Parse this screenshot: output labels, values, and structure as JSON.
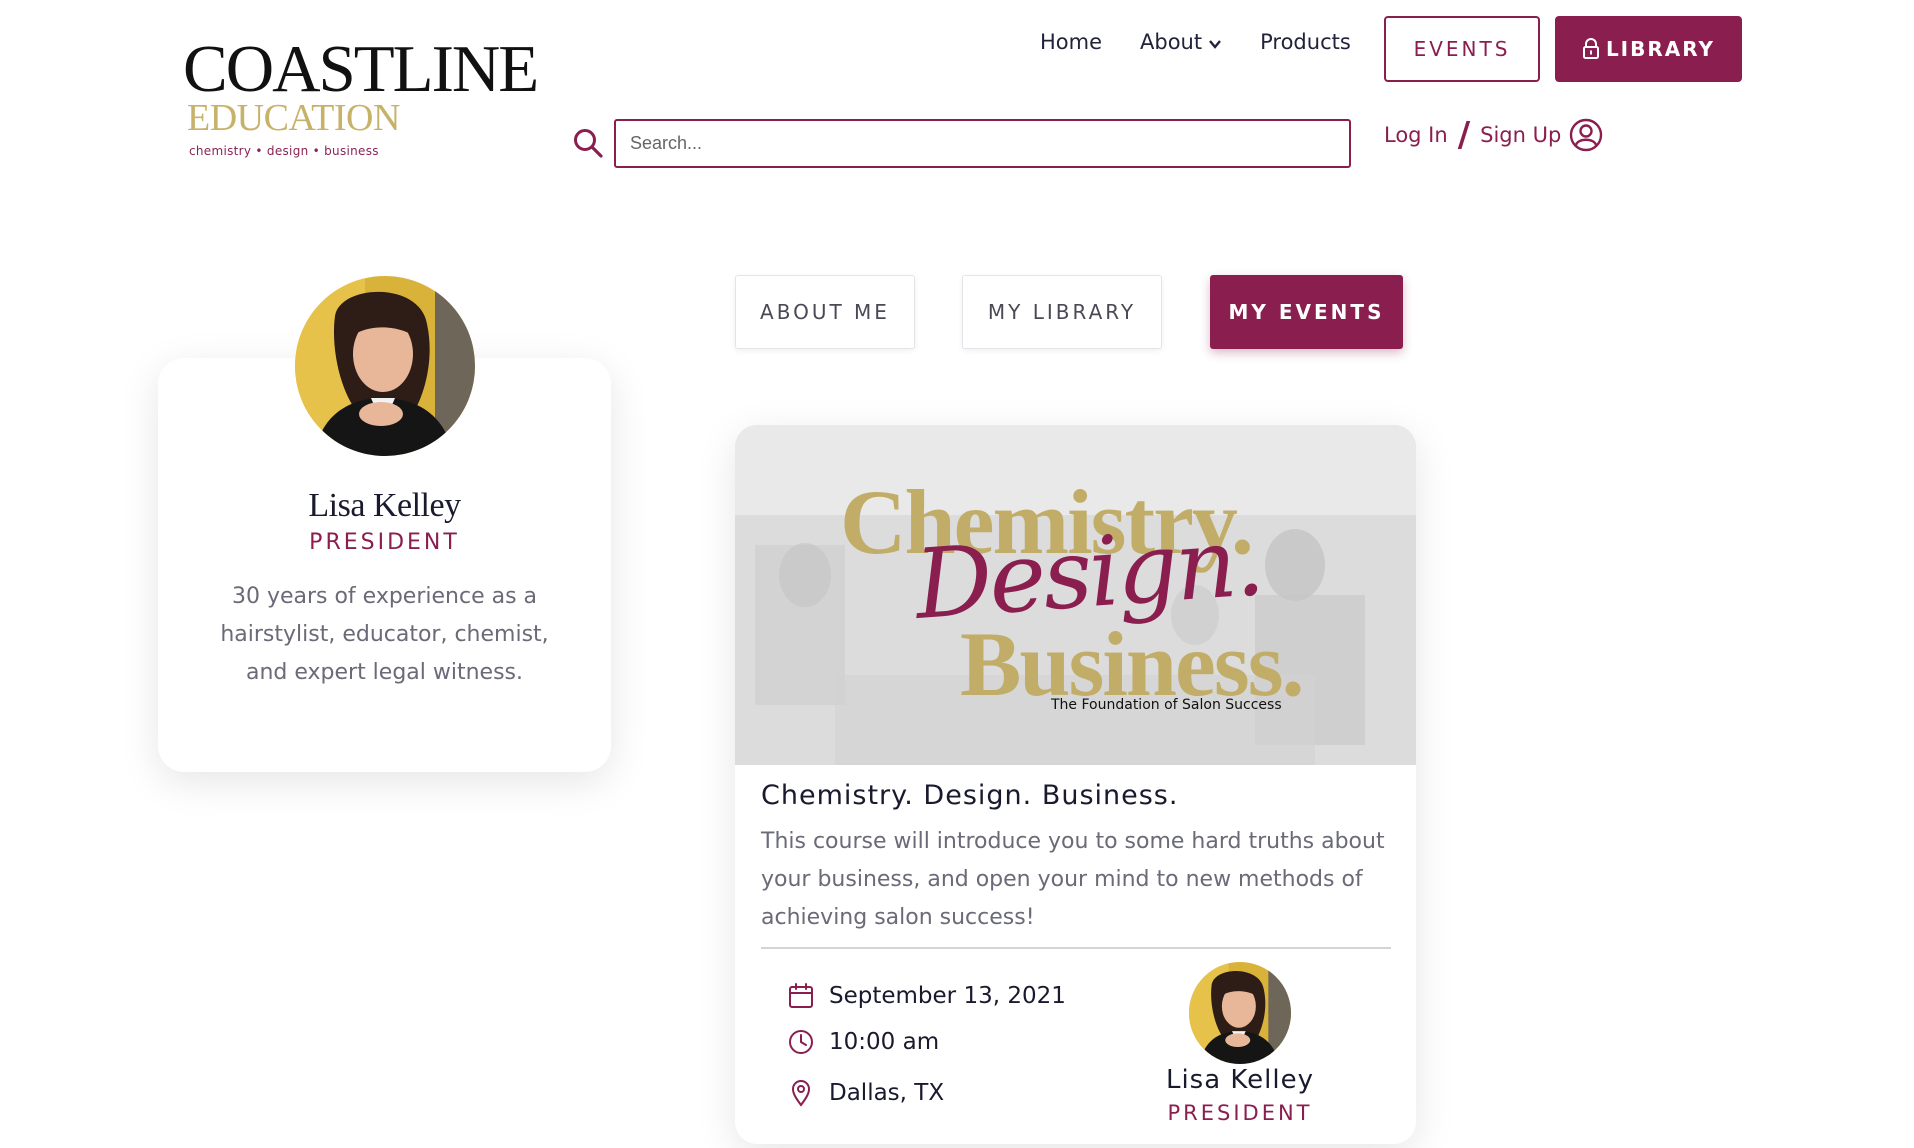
{
  "brand": {
    "name": "COASTLINE",
    "sub": "EDUCATION",
    "tagline": "chemistry • design • business"
  },
  "nav": {
    "home": "Home",
    "about": "About",
    "products": "Products",
    "events_button": "EVENTS",
    "library_button": "LIBRARY"
  },
  "search": {
    "placeholder": "Search..."
  },
  "auth": {
    "login": "Log In",
    "separator": "/",
    "signup": "Sign Up"
  },
  "profile": {
    "name": "Lisa Kelley",
    "role": "PRESIDENT",
    "bio": "30 years of experience as a hairstylist, educator, chemist, and expert legal witness."
  },
  "tabs": {
    "about_me": "ABOUT ME",
    "my_library": "MY LIBRARY",
    "my_events": "MY EVENTS",
    "active": "my_events"
  },
  "event": {
    "banner": {
      "line1": "Chemistry.",
      "line2": "Design.",
      "line3": "Business.",
      "tagline": "The Foundation of Salon Success"
    },
    "title": "Chemistry. Design. Business.",
    "description": "This course will introduce you to some hard truths about your business, and open your mind to new methods of achieving salon success!",
    "date": "September 13, 2021",
    "time": "10:00 am",
    "location": "Dallas, TX",
    "host_name": "Lisa Kelley",
    "host_role": "PRESIDENT"
  },
  "colors": {
    "accent": "#8a1f4f",
    "gold": "#c2ad68",
    "text_dark": "#1a1a2e",
    "text_muted": "#6a6a78"
  }
}
